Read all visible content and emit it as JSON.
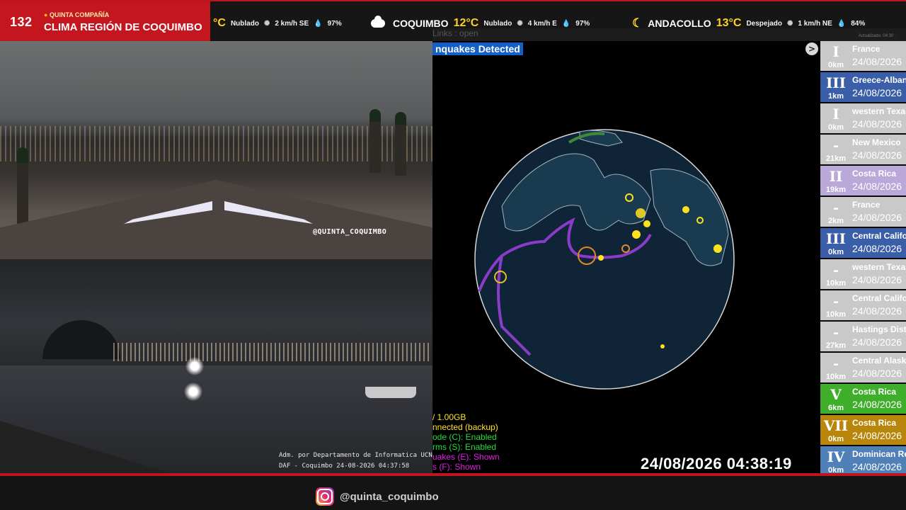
{
  "brand": {
    "channel_number": "132",
    "company": "QUINTA COMPAÑÍA",
    "title": "CLIMA REGIÓN DE COQUIMBO"
  },
  "weather": [
    {
      "city": "",
      "temp": "°C",
      "condition": "Nublado",
      "wind": "2 km/h SE",
      "humidity": "97%",
      "icon": "cloud-icon"
    },
    {
      "city": "COQUIMBO",
      "temp": "12°C",
      "condition": "Nublado",
      "wind": "4 km/h E",
      "humidity": "97%",
      "icon": "cloud-icon"
    },
    {
      "city": "ANDACOLLO",
      "temp": "13°C",
      "condition": "Despejado",
      "wind": "1 km/h NE",
      "humidity": "84%",
      "icon": "moon-icon"
    }
  ],
  "links_text": "Links : open",
  "updated_text": "Actualizado: 04:30 ·",
  "camera1": {
    "handle": "@QUINTA_COQUIMBO"
  },
  "camera2": {
    "credit_line1": "Adm. por Departamento de Informatica UCN",
    "credit_line2": "DAF - Coquimbo      24-08-2026 04:37:58"
  },
  "seismic": {
    "banner": "nquakes Detected",
    "arrow": ">",
    "status_lines": [
      {
        "text": "/ 1.00GB",
        "color": "#ffe21f"
      },
      {
        "text": "nnected (backup)",
        "color": "#ffe21f"
      },
      {
        "text": "ode (C): Enabled",
        "color": "#20e03a"
      },
      {
        "text": "rms (S): Enabled",
        "color": "#20e03a"
      },
      {
        "text": "uakes (E): Shown",
        "color": "#e020e0"
      },
      {
        "text": "s (F): Shown",
        "color": "#e020e0"
      }
    ],
    "clock": "24/08/2026 04:38:19"
  },
  "quakes": [
    {
      "mmi": "I",
      "distance": "0km",
      "place": "France",
      "date": "24/08/2026",
      "color": "#f2f2f2",
      "text_color": "#fff",
      "mmi_color": "#333"
    },
    {
      "mmi": "III",
      "distance": "1km",
      "place": "Greece-Albania",
      "date": "24/08/2026",
      "color": "#3a5ea8",
      "text_color": "#fff",
      "mmi_color": "#fff"
    },
    {
      "mmi": "I",
      "distance": "0km",
      "place": "western Texas",
      "date": "24/08/2026",
      "color": "#f2f2f2",
      "text_color": "#fff",
      "mmi_color": "#333"
    },
    {
      "mmi": "-",
      "distance": "21km",
      "place": "New Mexico",
      "date": "24/08/2026",
      "color": "#e0e0e0",
      "text_color": "#fff",
      "mmi_color": "#333"
    },
    {
      "mmi": "II",
      "distance": "19km",
      "place": "Costa Rica",
      "date": "24/08/2026",
      "color": "#b9a8d8",
      "text_color": "#fff",
      "mmi_color": "#fff"
    },
    {
      "mmi": "-",
      "distance": "2km",
      "place": "France",
      "date": "24/08/2026",
      "color": "#e0e0e0",
      "text_color": "#fff",
      "mmi_color": "#333"
    },
    {
      "mmi": "III",
      "distance": "0km",
      "place": "Central California",
      "date": "24/08/2026",
      "color": "#3a5ea8",
      "text_color": "#fff",
      "mmi_color": "#fff"
    },
    {
      "mmi": "-",
      "distance": "10km",
      "place": "western Texas",
      "date": "24/08/2026",
      "color": "#e0e0e0",
      "text_color": "#fff",
      "mmi_color": "#333"
    },
    {
      "mmi": "-",
      "distance": "10km",
      "place": "Central California",
      "date": "24/08/2026",
      "color": "#e0e0e0",
      "text_color": "#fff",
      "mmi_color": "#333"
    },
    {
      "mmi": "-",
      "distance": "27km",
      "place": "Hastings District",
      "date": "24/08/2026",
      "color": "#e0e0e0",
      "text_color": "#fff",
      "mmi_color": "#333"
    },
    {
      "mmi": "-",
      "distance": "10km",
      "place": "Central Alaska",
      "date": "24/08/2026",
      "color": "#e0e0e0",
      "text_color": "#fff",
      "mmi_color": "#333"
    },
    {
      "mmi": "V",
      "distance": "6km",
      "place": "Costa Rica",
      "date": "24/08/2026",
      "color": "#3fae2a",
      "text_color": "#fff",
      "mmi_color": "#fff"
    },
    {
      "mmi": "VII",
      "distance": "0km",
      "place": "Costa Rica",
      "date": "24/08/2026",
      "color": "#b8860b",
      "text_color": "#fff",
      "mmi_color": "#fff"
    },
    {
      "mmi": "IV",
      "distance": "0km",
      "place": "Dominican Republic",
      "date": "24/08/2026",
      "color": "#4f80b8",
      "text_color": "#fff",
      "mmi_color": "#fff"
    }
  ],
  "footer": {
    "instagram_handle": "@quinta_coquimbo",
    "icon": "instagram-icon"
  }
}
